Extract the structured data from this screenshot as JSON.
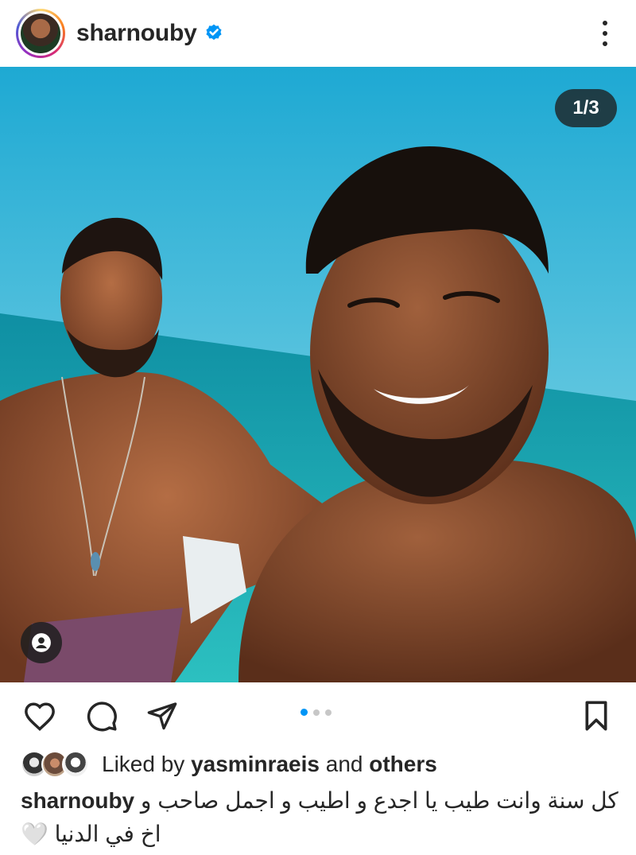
{
  "header": {
    "username": "sharnouby",
    "verified": true,
    "avatar_icon": "profile-avatar",
    "more_icon": "more-vertical-icon"
  },
  "post": {
    "image_counter": "1/3",
    "tag_icon": "user-tag-icon",
    "carousel": {
      "total": 3,
      "current": 1
    }
  },
  "actions": {
    "like_icon": "heart-icon",
    "comment_icon": "comment-icon",
    "share_icon": "send-icon",
    "save_icon": "bookmark-icon"
  },
  "likes": {
    "prefix": "Liked by ",
    "user": "yasminraeis",
    "middle": " and ",
    "suffix": "others"
  },
  "caption": {
    "username": "sharnouby",
    "text": "كل سنة وانت طيب يا اجدع و اطيب و اجمل صاحب و اخ في الدنيا 🤍"
  },
  "colors": {
    "accent": "#0095f6",
    "text": "#262626",
    "verified": "#0095f6",
    "sea": "#1aa9b5",
    "sky": "#39b6d6"
  }
}
